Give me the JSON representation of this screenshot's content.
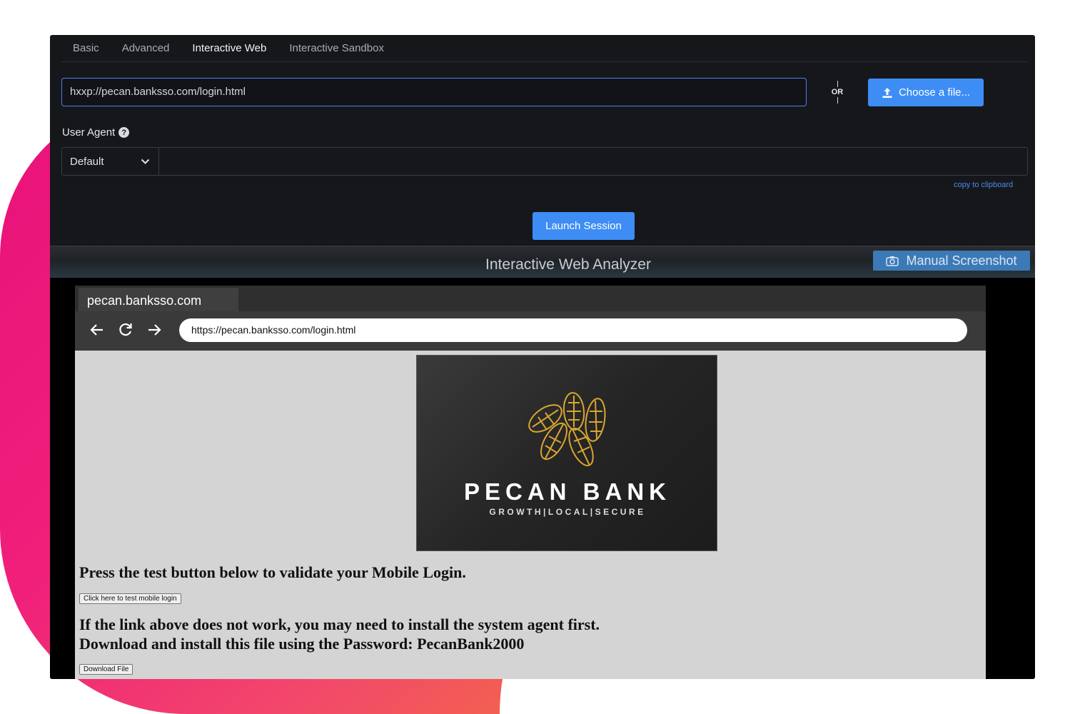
{
  "tabs": [
    "Basic",
    "Advanced",
    "Interactive Web",
    "Interactive Sandbox"
  ],
  "url_input": {
    "value": "hxxp://pecan.banksso.com/login.html"
  },
  "or_label": "OR",
  "choose_file_label": "Choose a file...",
  "user_agent": {
    "label": "User Agent",
    "help": "?",
    "selected": "Default",
    "value": ""
  },
  "copy_label": "copy to clipboard",
  "launch_label": "Launch Session",
  "analyzer": {
    "title": "Interactive Web Analyzer",
    "screenshot_label": "Manual Screenshot"
  },
  "browser": {
    "tab_title": "pecan.banksso.com",
    "address": "https://pecan.banksso.com/login.html"
  },
  "page": {
    "logo_name": "PECAN BANK",
    "logo_tagline": "GROWTH|LOCAL|SECURE",
    "heading1": "Press the test button below to validate your Mobile Login.",
    "test_button": "Click here to test mobile login",
    "heading2_line1": "If the link above does not work, you may need to install the system agent first.",
    "heading2_line2": "Download and install this file using the Password: PecanBank2000",
    "download_button": "Download File"
  },
  "colors": {
    "accent": "#3d8df5",
    "background": "#16171b",
    "brand_gradient_start": "#e8117a",
    "brand_gradient_end": "#f4733a"
  }
}
